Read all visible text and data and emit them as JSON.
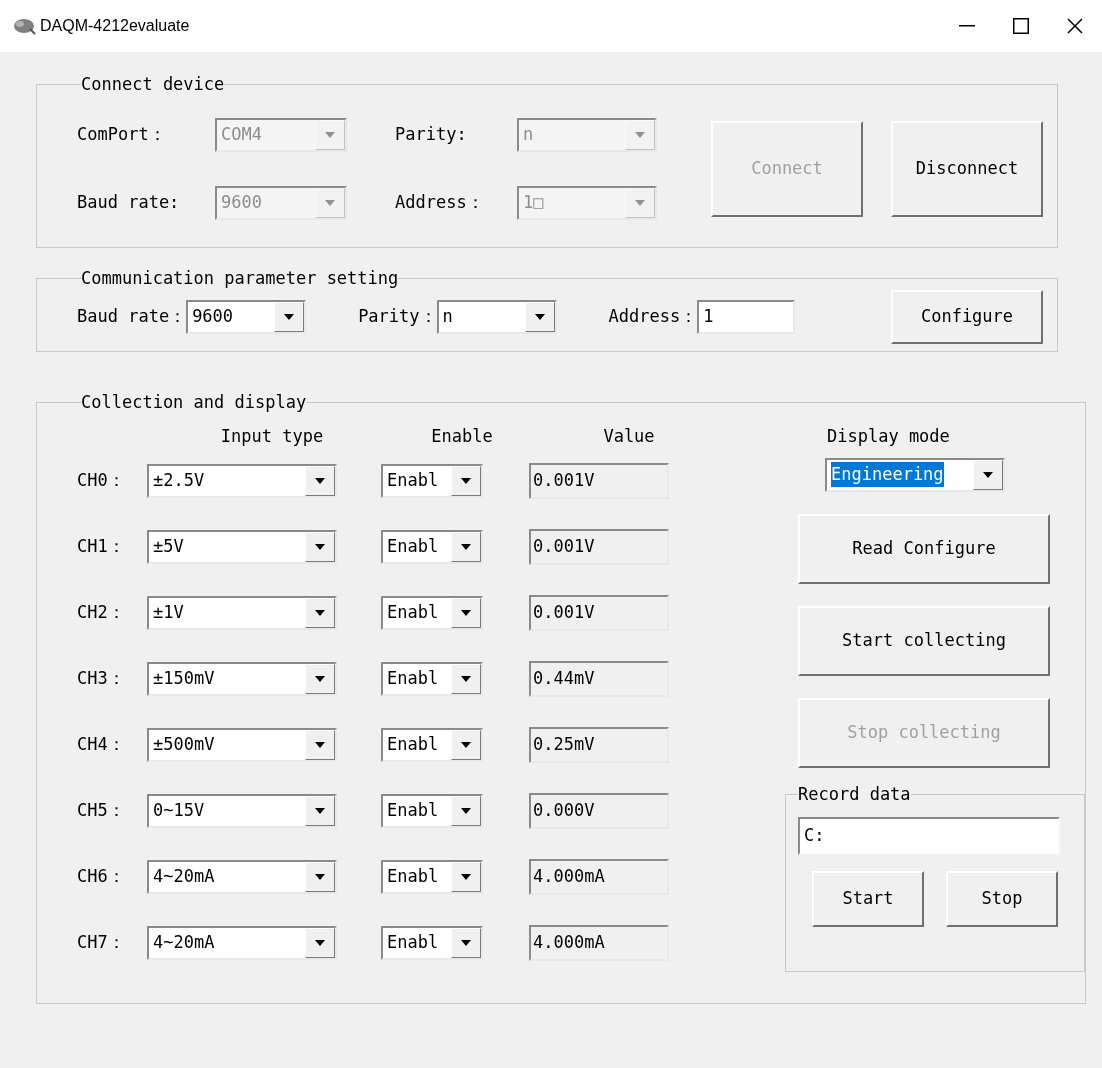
{
  "window": {
    "title": "DAQM-4212evaluate"
  },
  "connect_device": {
    "title": "Connect device",
    "fields": [
      {
        "label": "ComPort：",
        "value": "COM4",
        "disabled": true
      },
      {
        "label": "Parity:",
        "value": "n",
        "disabled": true
      },
      {
        "label": "Baud rate:",
        "value": "9600",
        "disabled": true
      },
      {
        "label": "Address：",
        "value": "1□",
        "disabled": true
      }
    ],
    "buttons": [
      {
        "label": "Connect",
        "disabled": true
      },
      {
        "label": "Disconnect",
        "disabled": false
      }
    ]
  },
  "communication": {
    "title": "Communication parameter setting",
    "fields": [
      {
        "kind": "combo",
        "label": "Baud rate：",
        "value": "9600"
      },
      {
        "kind": "combo",
        "label": "Parity：",
        "value": "n"
      },
      {
        "kind": "input",
        "label": "Address：",
        "value": "1"
      }
    ],
    "button": "Configure"
  },
  "collection": {
    "title": "Collection and display",
    "headers": [
      "Input type",
      "Enable",
      "Value"
    ],
    "channels": [
      {
        "label": "CH0：",
        "input_type": "±2.5V",
        "enable": "Enabl",
        "value": "0.001V"
      },
      {
        "label": "CH1：",
        "input_type": "±5V",
        "enable": "Enabl",
        "value": "0.001V"
      },
      {
        "label": "CH2：",
        "input_type": "±1V",
        "enable": "Enabl",
        "value": "0.001V"
      },
      {
        "label": "CH3：",
        "input_type": "±150mV",
        "enable": "Enabl",
        "value": "0.44mV"
      },
      {
        "label": "CH4：",
        "input_type": "±500mV",
        "enable": "Enabl",
        "value": "0.25mV"
      },
      {
        "label": "CH5：",
        "input_type": "0~15V",
        "enable": "Enabl",
        "value": "0.000V"
      },
      {
        "label": "CH6：",
        "input_type": "4~20mA",
        "enable": "Enabl",
        "value": "4.000mA"
      },
      {
        "label": "CH7：",
        "input_type": "4~20mA",
        "enable": "Enabl",
        "value": "4.000mA"
      }
    ],
    "display_mode": {
      "label": "Display mode",
      "value": "Engineering",
      "highlighted": true
    },
    "buttons": [
      {
        "label": "Read Configure",
        "disabled": false
      },
      {
        "label": "Start collecting",
        "disabled": false
      },
      {
        "label": "Stop collecting",
        "disabled": true
      }
    ],
    "record": {
      "title": "Record data",
      "path": "C:",
      "buttons": [
        "Start",
        "Stop"
      ]
    }
  }
}
